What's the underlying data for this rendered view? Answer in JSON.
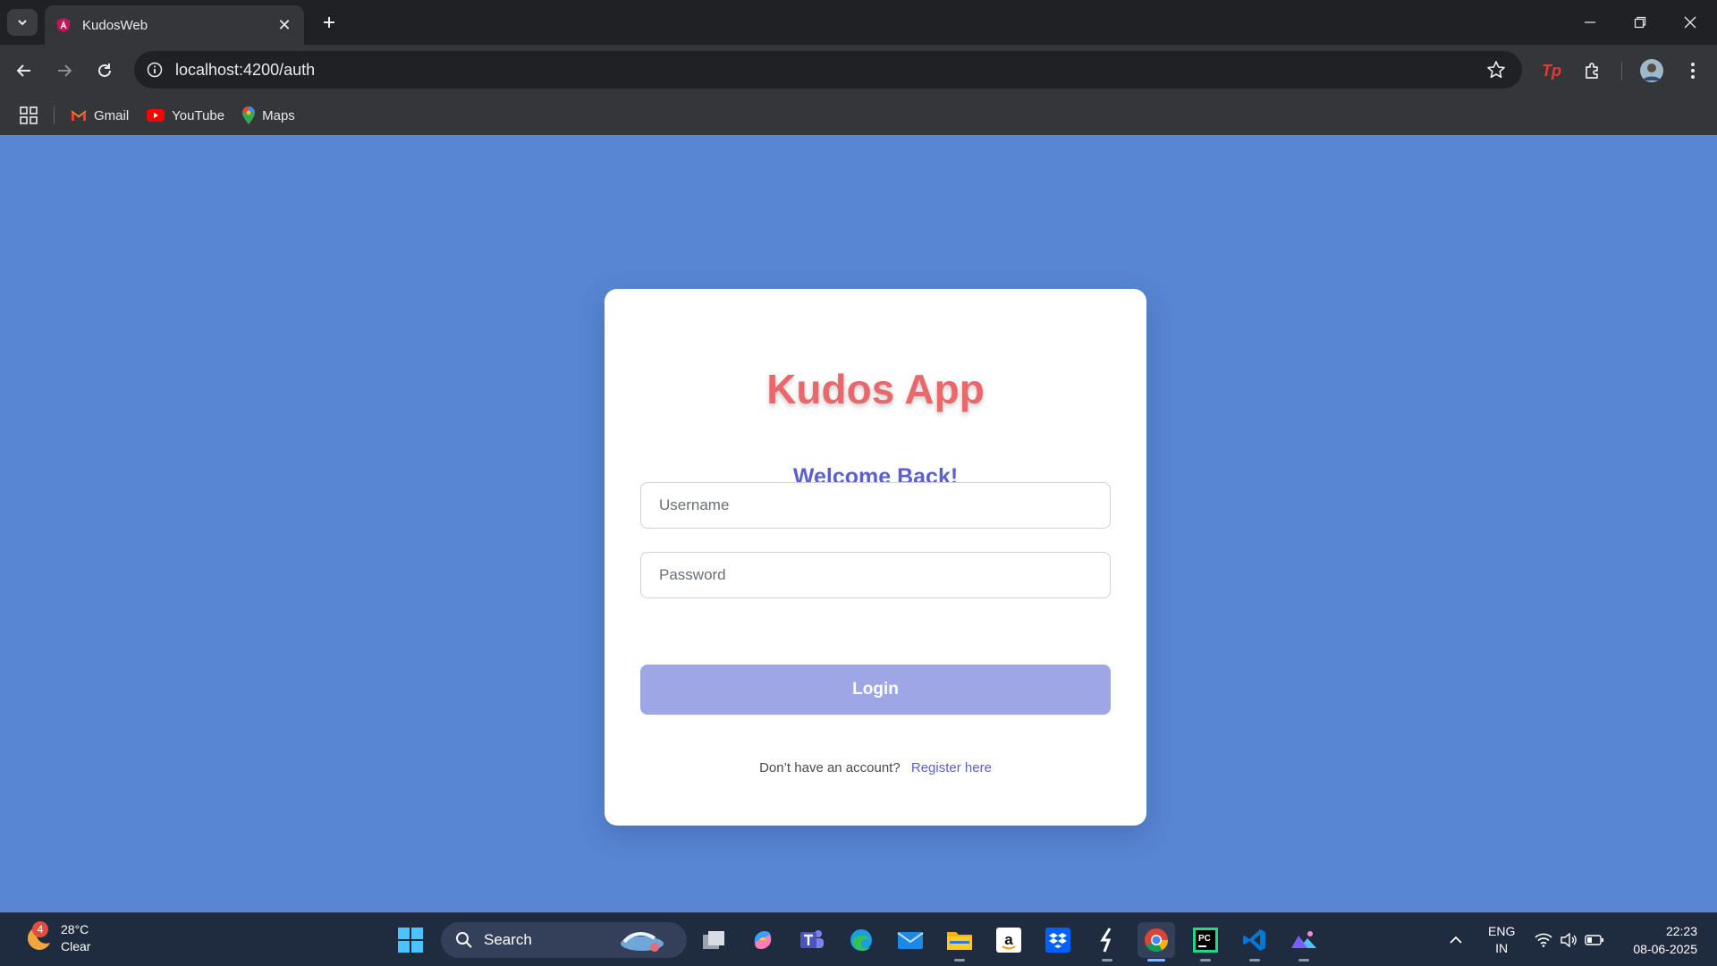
{
  "browser": {
    "tab_title": "KudosWeb",
    "url": "localhost:4200/auth",
    "bookmarks": [
      {
        "label": "Gmail"
      },
      {
        "label": "YouTube"
      },
      {
        "label": "Maps"
      }
    ]
  },
  "login": {
    "app_title": "Kudos App",
    "welcome": "Welcome Back!",
    "username_placeholder": "Username",
    "password_placeholder": "Password",
    "login_label": "Login",
    "no_account_text": "Don’t have an account?",
    "register_link": "Register here"
  },
  "colors": {
    "page_background": "#5886d3",
    "title": "#e9686b",
    "accent": "#5b5fcf",
    "button": "#9ea6e6"
  },
  "taskbar": {
    "weather_badge": "4",
    "temperature": "28°C",
    "condition": "Clear",
    "search_label": "Search",
    "language": "ENG",
    "region": "IN",
    "time": "22:23",
    "date": "08-06-2025"
  }
}
